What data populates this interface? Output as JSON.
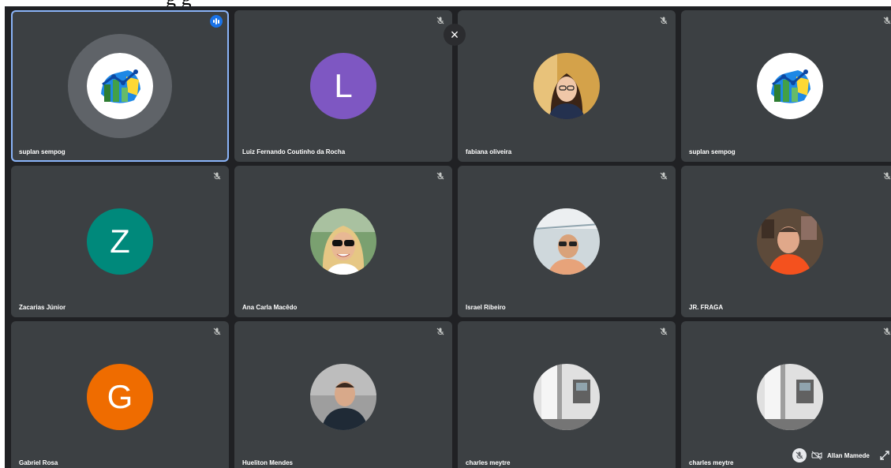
{
  "close_button": {
    "glyph": "×"
  },
  "participants": [
    {
      "name": "suplan sempog",
      "avatar": "logo",
      "speaking": true
    },
    {
      "name": "Luiz Fernando Coutinho da Rocha",
      "avatar": "letter",
      "letter": "L",
      "color": "#7e57c2"
    },
    {
      "name": "fabiana oliveira",
      "avatar": "photo"
    },
    {
      "name": "suplan sempog",
      "avatar": "logo"
    },
    {
      "name": "Zacarias Júnior",
      "avatar": "letter",
      "letter": "Z",
      "color": "#00897b"
    },
    {
      "name": "Ana Carla Macêdo",
      "avatar": "photo"
    },
    {
      "name": "Israel Ribeiro",
      "avatar": "photo"
    },
    {
      "name": "JR. FRAGA",
      "avatar": "photo"
    },
    {
      "name": "Gabriel Rosa",
      "avatar": "letter",
      "letter": "G",
      "color": "#ef6c00"
    },
    {
      "name": "Hueliton Mendes",
      "avatar": "photo"
    },
    {
      "name": "charles meytre",
      "avatar": "photo"
    },
    {
      "name": "charles meytre",
      "avatar": "photo"
    }
  ],
  "self_view": {
    "name": "Allan Mamede"
  },
  "icons": {
    "mic_off": "mic-off-icon",
    "speaking": "speaking-indicator-icon",
    "camera_off": "camera-off-icon",
    "expand": "expand-icon",
    "close": "close-icon"
  }
}
